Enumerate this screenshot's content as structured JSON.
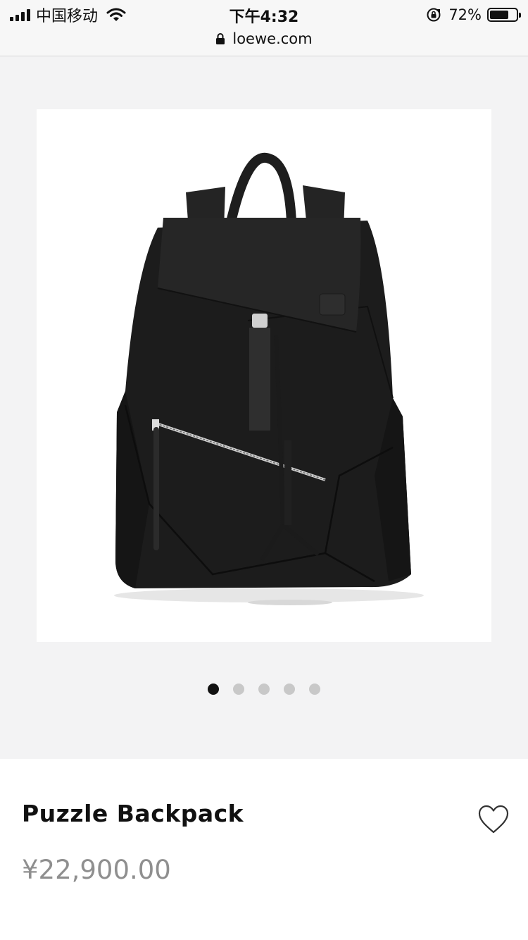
{
  "status_bar": {
    "carrier": "中国移动",
    "time": "下午4:32",
    "battery_percent": "72%",
    "battery_level": 0.72,
    "url": "loewe.com"
  },
  "gallery": {
    "image_icon": "backpack-image",
    "slide_count": 5,
    "active_slide": 1
  },
  "product": {
    "name": "Puzzle Backpack",
    "price": "¥22,900.00",
    "wishlist_icon": "heart-icon"
  },
  "colors": {
    "gallery_bg": "#f3f3f4",
    "price_text": "#8f8f8f",
    "dot_active": "#111111",
    "dot_inactive": "#c8c8c8"
  }
}
